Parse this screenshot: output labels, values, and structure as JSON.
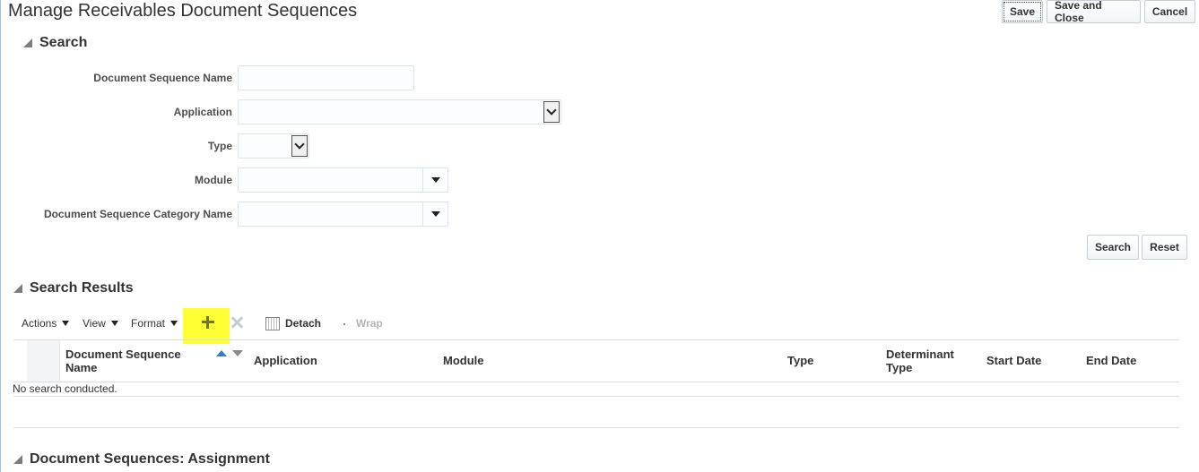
{
  "page": {
    "title": "Manage Receivables Document Sequences"
  },
  "header_actions": {
    "save": "Save",
    "save_and_close": "Save and Close",
    "cancel": "Cancel"
  },
  "search": {
    "title": "Search",
    "fields": {
      "doc_seq_name": {
        "label": "Document Sequence Name",
        "value": ""
      },
      "application": {
        "label": "Application",
        "value": ""
      },
      "type": {
        "label": "Type",
        "value": ""
      },
      "module": {
        "label": "Module",
        "value": ""
      },
      "category": {
        "label": "Document Sequence Category Name",
        "value": ""
      }
    },
    "search_button": "Search",
    "reset_button": "Reset"
  },
  "results": {
    "title": "Search Results",
    "toolbar": {
      "actions": "Actions",
      "view": "View",
      "format": "Format",
      "detach": "Detach",
      "wrap": "Wrap"
    },
    "columns": {
      "name": "Document Sequence Name",
      "application": "Application",
      "module": "Module",
      "type": "Type",
      "determinant_type": "Determinant Type",
      "start_date": "Start Date",
      "end_date": "End Date"
    },
    "empty_message": "No search conducted."
  },
  "assignment": {
    "title": "Document Sequences: Assignment"
  },
  "icons": {
    "add": "plus-icon",
    "delete": "x-icon",
    "detach": "detach-icon",
    "collapse": "triangle-icon",
    "sort_asc": "sort-ascending-icon",
    "sort_desc": "sort-descending-icon"
  },
  "colors": {
    "highlight": "#ffff33",
    "sort_active": "#2f7fc6",
    "add_icon": "#6f7a1a"
  }
}
